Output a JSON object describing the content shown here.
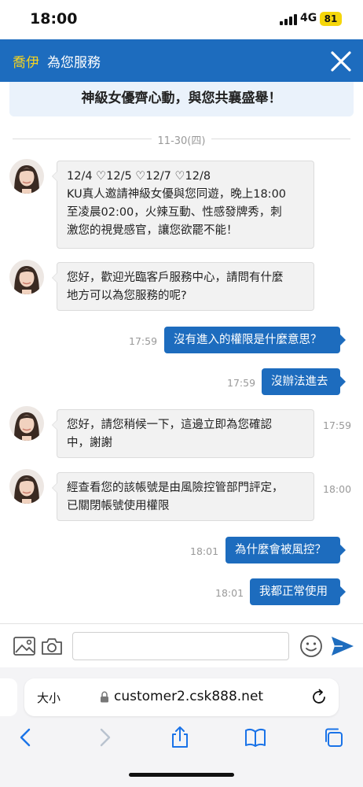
{
  "status": {
    "time": "18:00",
    "network": "4G",
    "battery": "81"
  },
  "header": {
    "brand": "喬伊",
    "subtitle": "為您服務"
  },
  "banner": {
    "text": "神級女優齊心動，與您共襄盛舉！"
  },
  "chat": {
    "date": "11-30(四)",
    "messages": [
      {
        "lines": [
          "12/4 ♡12/5 ♡12/7 ♡12/8",
          "KU真人邀請神級女優與您同遊，晚上18:00",
          "至凌晨02:00，火辣互動、性感發牌秀，刺",
          "激您的視覺感官，讓您欲罷不能！"
        ]
      },
      {
        "lines": [
          "您好，歡迎光臨客戶服務中心，請問有什麼",
          "地方可以為您服務的呢?"
        ]
      },
      {
        "text": "沒有進入的權限是什麼意思？",
        "time": "17:59"
      },
      {
        "text": "沒辦法進去",
        "time": "17:59"
      },
      {
        "lines": [
          "您好，請您稍候一下，這邊立即為您確認",
          "中，謝謝"
        ],
        "time": "17:59"
      },
      {
        "lines": [
          "經查看您的該帳號是由風險控管部門評定，",
          "已關閉帳號使用權限"
        ],
        "time": "18:00"
      },
      {
        "text": "為什麼會被風控？",
        "time": "18:01"
      },
      {
        "text": "我都正常使用",
        "time": "18:01"
      }
    ]
  },
  "input": {
    "placeholder": ""
  },
  "safari": {
    "aa_label": "大小",
    "url": "customer2.csk888.net"
  },
  "colors": {
    "primary": "#1d6cbe",
    "brand": "#f5d320",
    "battery": "#f5d60a"
  }
}
